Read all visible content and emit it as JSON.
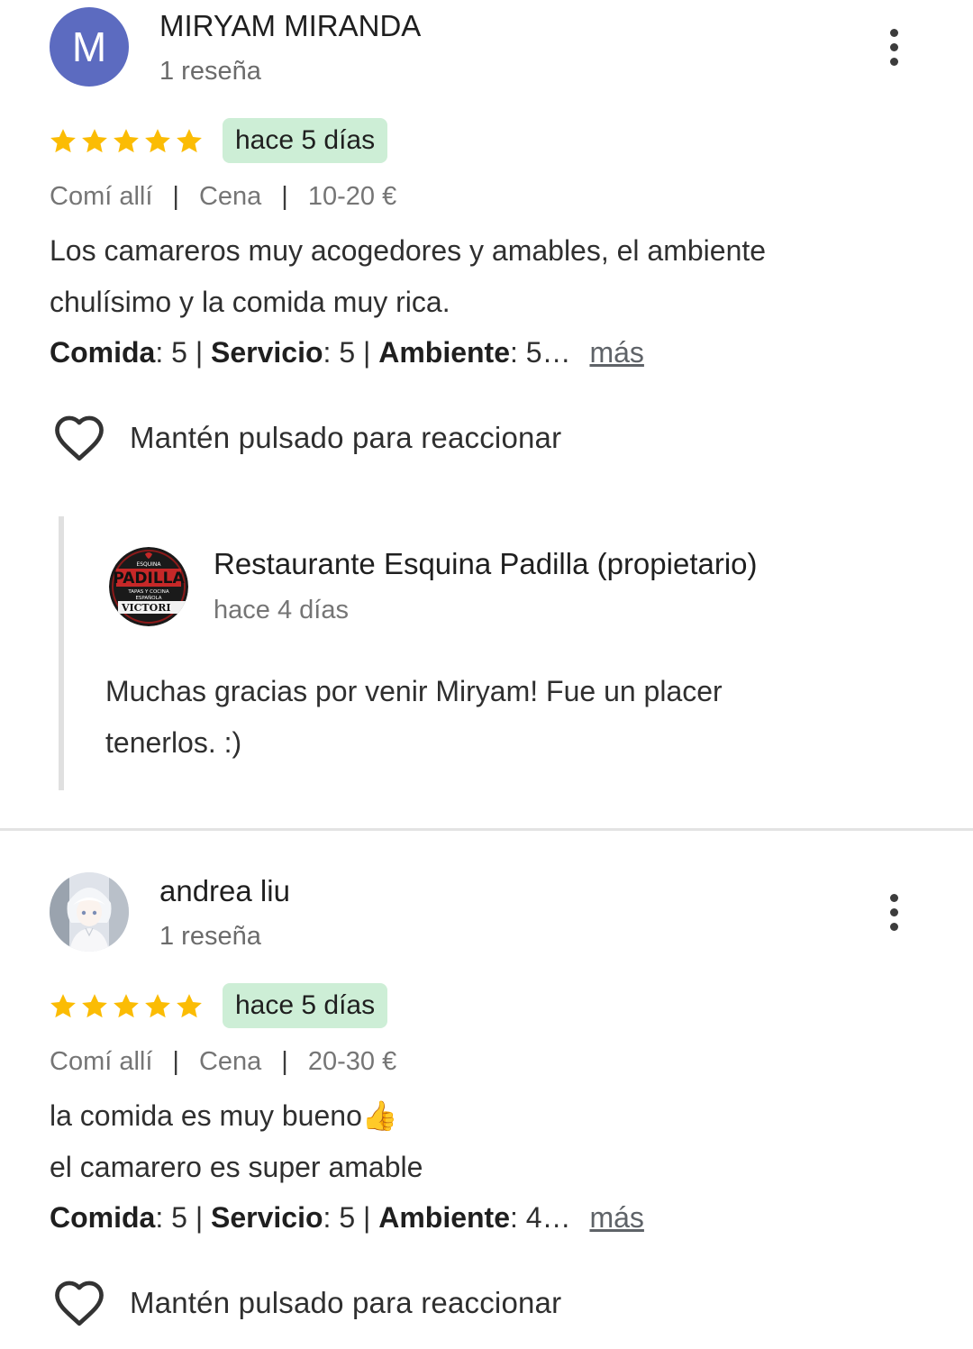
{
  "colors": {
    "star": "#fbbc04",
    "date_badge_bg": "#cdeed6",
    "avatar_letter_bg": "#5c6bc0"
  },
  "reviews": [
    {
      "avatar_letter": "M",
      "name": "MIRYAM MIRANDA",
      "review_count": "1 reseña",
      "rating": 5,
      "date": "hace 5 días",
      "meta": [
        "Comí allí",
        "Cena",
        "10-20 €"
      ],
      "text_lines": [
        "Los camareros muy acogedores y amables, el ambiente",
        "chulísimo y la comida muy rica."
      ],
      "ratings": {
        "food_label": "Comida",
        "food_value": "5",
        "service_label": "Servicio",
        "service_value": "5",
        "ambience_label": "Ambiente",
        "ambience_value": "5…"
      },
      "more_label": "más",
      "react_label": "Mantén pulsado para reaccionar",
      "owner_reply": {
        "logo_lines": [
          "ESQUINA",
          "PADILLA",
          "TAPAS Y COCINA",
          "ESPAÑOLA",
          "VICTORI"
        ],
        "name": "Restaurante Esquina Padilla (propietario)",
        "date": "hace 4 días",
        "text_lines": [
          "Muchas gracias por venir Miryam! Fue un placer",
          "tenerlos. :)"
        ]
      }
    },
    {
      "name": "andrea liu",
      "review_count": "1 reseña",
      "rating": 5,
      "date": "hace 5 días",
      "meta": [
        "Comí allí",
        "Cena",
        "20-30 €"
      ],
      "text_lines": [
        "la comida es muy bueno👍",
        "el camarero es super amable"
      ],
      "ratings": {
        "food_label": "Comida",
        "food_value": "5",
        "service_label": "Servicio",
        "service_value": "5",
        "ambience_label": "Ambiente",
        "ambience_value": "4…"
      },
      "more_label": "más",
      "react_label": "Mantén pulsado para reaccionar"
    }
  ]
}
